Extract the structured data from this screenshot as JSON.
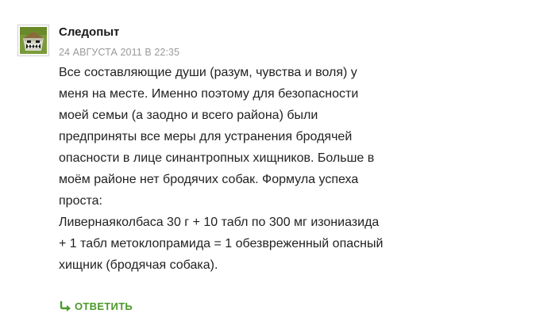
{
  "comment": {
    "author": "Следопыт",
    "date": "24 АВГУСТА 2011 В 22:35",
    "text": "Все составляющие души (разум, чувства и воля) у\nменя на месте. Именно поэтому для безопасности\nмоей семьи (а заодно и всего района) были\nпредприняты все меры для устранения бродячей\nопасности в лице синантропных хищников. Больше в\nмоём районе нет бродячих собак. Формула успеха\nпроста:\nЛивернаяколбаса 30 г + 10 табл по 300 мг изониазида\n+ 1 табл метоклопрамида = 1 обезвреженный опасный\nхищник (бродячая собака).",
    "reply_label": "ОТВЕТИТЬ",
    "avatar_icon": "monster-avatar-icon",
    "reply_icon": "reply-arrow-icon"
  },
  "colors": {
    "accent": "#4a9a2a",
    "date": "#9a9a9a",
    "text": "#222222"
  }
}
